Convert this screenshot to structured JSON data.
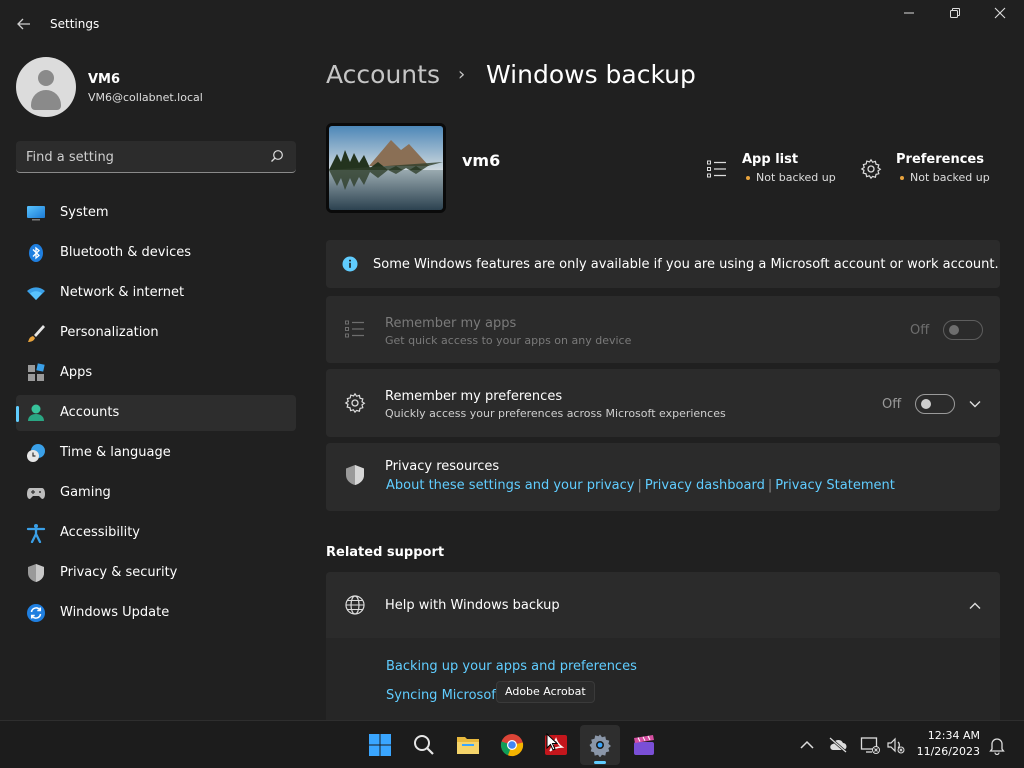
{
  "window": {
    "title": "Settings",
    "controls": {
      "minimize": "─",
      "maximize": "❐",
      "close": "✕"
    }
  },
  "user": {
    "name": "VM6",
    "email": "VM6@collabnet.local"
  },
  "search": {
    "placeholder": "Find a setting"
  },
  "sidebar": {
    "items": [
      {
        "label": "System",
        "icon": "system-icon"
      },
      {
        "label": "Bluetooth & devices",
        "icon": "bluetooth-icon"
      },
      {
        "label": "Network & internet",
        "icon": "network-icon"
      },
      {
        "label": "Personalization",
        "icon": "brush-icon"
      },
      {
        "label": "Apps",
        "icon": "apps-icon"
      },
      {
        "label": "Accounts",
        "icon": "accounts-icon",
        "active": true
      },
      {
        "label": "Time & language",
        "icon": "clock-globe-icon"
      },
      {
        "label": "Gaming",
        "icon": "gamepad-icon"
      },
      {
        "label": "Accessibility",
        "icon": "accessibility-icon"
      },
      {
        "label": "Privacy & security",
        "icon": "shield-icon"
      },
      {
        "label": "Windows Update",
        "icon": "update-icon"
      }
    ]
  },
  "breadcrumb": {
    "parent": "Accounts",
    "separator": "›",
    "current": "Windows backup"
  },
  "device": {
    "name": "vm6"
  },
  "status": {
    "app_list": {
      "title": "App list",
      "state": "Not backed up"
    },
    "preferences": {
      "title": "Preferences",
      "state": "Not backed up"
    }
  },
  "info_banner": {
    "text": "Some Windows features are only available if you are using a Microsoft account or work account."
  },
  "remember_apps": {
    "title": "Remember my apps",
    "subtitle": "Get quick access to your apps on any device",
    "toggle_state": "Off"
  },
  "remember_prefs": {
    "title": "Remember my preferences",
    "subtitle": "Quickly access your preferences across Microsoft experiences",
    "toggle_state": "Off"
  },
  "privacy": {
    "title": "Privacy resources",
    "links": [
      "About these settings and your privacy",
      "Privacy dashboard",
      "Privacy Statement"
    ],
    "separator": "|"
  },
  "related_support": {
    "title": "Related support",
    "help_title": "Help with Windows backup",
    "links": [
      "Backing up your apps and preferences",
      "Syncing Microsoft"
    ]
  },
  "tooltip": {
    "text": "Adobe Acrobat"
  },
  "taskbar": {
    "time": "12:34 AM",
    "date": "11/26/2023"
  },
  "colors": {
    "accent": "#60cdff",
    "background": "#202020",
    "card": "#2b2b2b",
    "warning_dot": "#e8a33d"
  }
}
